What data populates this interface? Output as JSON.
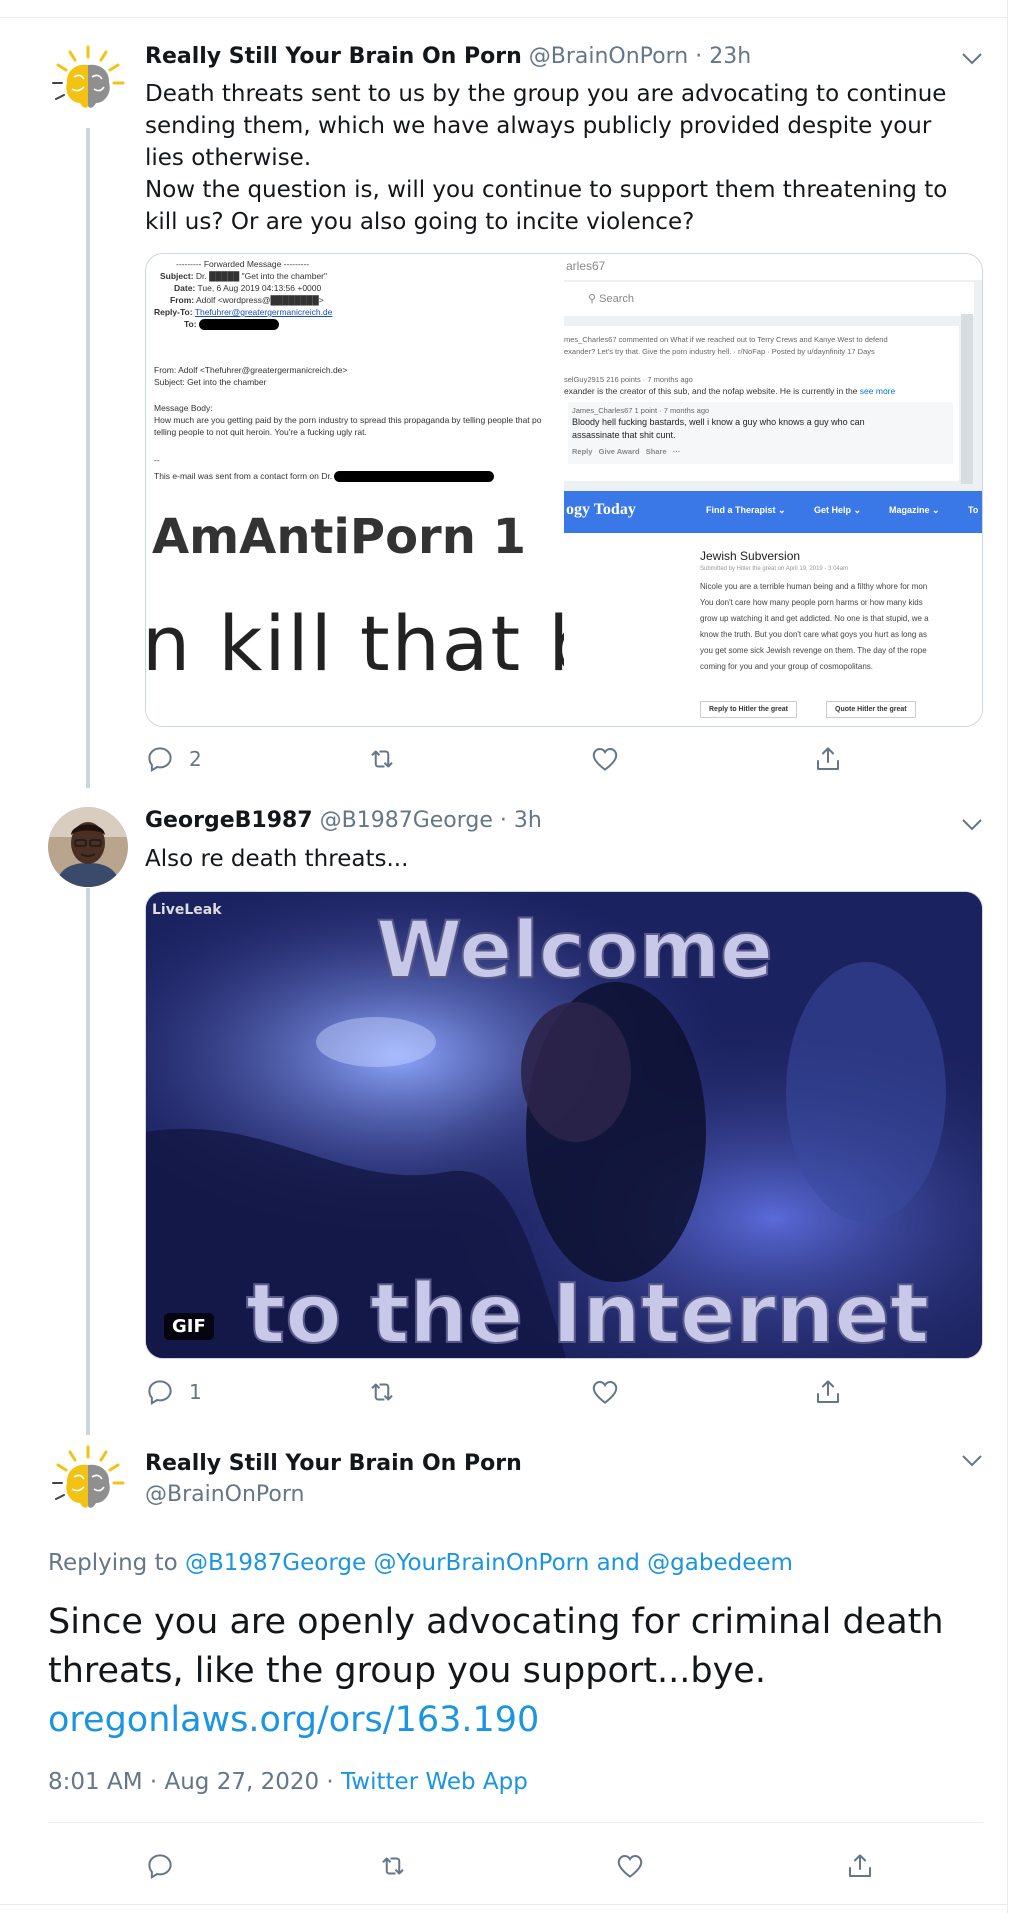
{
  "tweet1": {
    "name": "Really Still Your Brain On Porn",
    "handle": "@BrainOnPorn",
    "time": "23h",
    "text1": "Death threats sent to us by the group you are advocating to continue sending them, which we have always publicly provided despite your lies otherwise.",
    "text2": "Now the question is, will you continue to support them threatening to kill us? Or are you also going to incite violence?",
    "reply_count": "2",
    "media": {
      "email": {
        "forwarded": "--------- Forwarded Message ---------",
        "subject_label": "Subject:",
        "subject_value": "Dr. █████ \"Get into the chamber\"",
        "date_label": "Date:",
        "date_value": "Tue, 6 Aug 2019 04:13:56 +0000",
        "from_label": "From:",
        "from_value": "Adolf <wordpress@████████>",
        "replyto_label": "Reply-To:",
        "replyto_value": "Thefuhrer@greatergermanicreich.de",
        "to_label": "To:",
        "from2": "From: Adolf <Thefuhrer@greatergermanicreich.de>",
        "subject2": "Subject: Get into the chamber",
        "body_label": "Message Body:",
        "body_text": "How much are you getting paid by the porn industry to spread this propaganda by telling people that po telling people to not quit heroin. You're a fucking ugly rat.",
        "dashes": "--",
        "footer": "This e-mail was sent from a contact form on Dr."
      },
      "zoom1": "AmAntiPorn 1",
      "zoom2": "n kill that b",
      "reddit": {
        "title": "arles67",
        "search": "Search",
        "line1": "mes_Charles67 commented on What if we reached out to Terry Crews and Kanye West to defend",
        "line2": "exander? Let's try that. Give the porn industry hell. · r/NoFap · Posted by u/daynfinity 17 Days",
        "line3": "selGuy2915 216 points · 7 months ago",
        "line4": "exander is the creator of this sub, and the nofap website. He is currently in the",
        "see_more": "see more",
        "c_author": "James_Charles67 1 point · 7 months ago",
        "c_text1": "Bloody hell fucking bastards, well i know a guy who knows a guy who can",
        "c_text2": "assassinate that shit cunt.",
        "c_actions": "Reply   Give Award   Share   ···"
      },
      "pt": {
        "logo": "ogy Today",
        "nav1": "Find a Therapist ⌄",
        "nav2": "Get Help ⌄",
        "nav3": "Magazine ⌄",
        "nav4": "To",
        "title": "Jewish Subversion",
        "sub": "Submitted by Hitler the great on April 19, 2019 - 3:04am",
        "body1": "Nicole you are a terrible human being and a filthy whore for mon",
        "body2": "You don't care how many people porn harms or how many kids",
        "body3": "grow up watching it and get addicted. No one is that stupid, we a",
        "body4": "know the truth. But you don't care what goys you hurt as long as",
        "body5": "you get some sick Jewish revenge on them. The day of the rope",
        "body6": "coming for you and your group of cosmopolitans.",
        "btn1": "Reply to Hitler the great",
        "btn2": "Quote Hitler the great"
      }
    }
  },
  "tweet2": {
    "name": "GeorgeB1987",
    "handle": "@B1987George",
    "time": "3h",
    "text": "Also re death threats...",
    "reply_count": "1",
    "gif_top": "Welcome",
    "gif_bottom": "to the Internet",
    "gif_watermark": "LiveLeak",
    "gif_badge": "GIF"
  },
  "tweet3": {
    "name": "Really Still Your Brain On Porn",
    "handle": "@BrainOnPorn",
    "replying_prefix": "Replying to",
    "replying_to": "@B1987George @YourBrainOnPorn and @gabedeem",
    "text_line1": "Since you are openly advocating for criminal death",
    "text_line2": "threats, like the group you support...bye.",
    "url": "oregonlaws.org/ors/163.190",
    "time": "8:01 AM · Aug 27, 2020 ·",
    "source": "Twitter Web App"
  },
  "colors": {
    "link": "#1b95e0",
    "secondary": "#657786",
    "divider": "#e6ecf0",
    "thread_line": "#ccd6dd"
  },
  "icons": [
    "reply-icon",
    "retweet-icon",
    "like-icon",
    "share-icon",
    "chevron-down-icon"
  ]
}
